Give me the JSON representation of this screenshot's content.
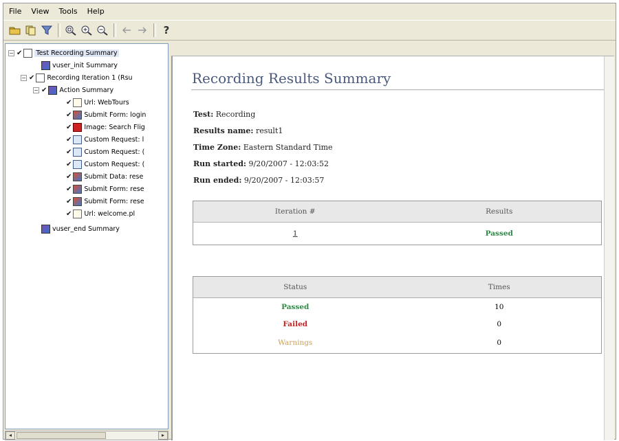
{
  "menu": [
    "File",
    "View",
    "Tools",
    "Help"
  ],
  "toolbar": {
    "icons": [
      "open-folder-icon",
      "copy-icon",
      "filter-icon",
      "zoom-fit-icon",
      "zoom-in-icon",
      "zoom-out-icon",
      "back-arrow-icon",
      "forward-arrow-icon"
    ],
    "help_label": "?"
  },
  "tree": {
    "root": "Test Recording Summary",
    "vuser_init": "vuser_init Summary",
    "iteration": "Recording Iteration 1 (Rsu",
    "action_summary": "Action Summary",
    "steps": [
      {
        "label": "Url: WebTours",
        "icon": "url-page-icon"
      },
      {
        "label": "Submit Form: login",
        "icon": "submit-form-icon"
      },
      {
        "label": "Image: Search Flig",
        "icon": "image-icon"
      },
      {
        "label": "Custom Request: l",
        "icon": "custom-request-icon"
      },
      {
        "label": "Custom Request: (",
        "icon": "custom-request-icon"
      },
      {
        "label": "Custom Request: (",
        "icon": "custom-request-icon"
      },
      {
        "label": "Submit Data: rese",
        "icon": "submit-data-icon"
      },
      {
        "label": "Submit Form: rese",
        "icon": "submit-form-icon"
      },
      {
        "label": "Submit Form: rese",
        "icon": "submit-form-icon"
      },
      {
        "label": "Url: welcome.pl",
        "icon": "url-page-icon"
      }
    ],
    "vuser_end": "vuser_end Summary"
  },
  "report": {
    "title": "Recording Results Summary",
    "meta": [
      {
        "label": "Test:",
        "value": "Recording"
      },
      {
        "label": "Results name:",
        "value": "result1"
      },
      {
        "label": "Time Zone:",
        "value": "Eastern Standard Time"
      },
      {
        "label": "Run started:",
        "value": "9/20/2007 - 12:03:52"
      },
      {
        "label": "Run ended:",
        "value": "9/20/2007 - 12:03:57"
      }
    ],
    "iteration_table": {
      "headers": [
        "Iteration #",
        "Results"
      ],
      "rows": [
        {
          "iteration": "1",
          "result": "Passed"
        }
      ]
    },
    "status_table": {
      "headers": [
        "Status",
        "Times"
      ],
      "rows": [
        {
          "status": "Passed",
          "times": "10"
        },
        {
          "status": "Failed",
          "times": "0"
        },
        {
          "status": "Warnings",
          "times": "0"
        }
      ]
    }
  },
  "colors": {
    "passed": "#2f8a46",
    "failed": "#c62020",
    "warnings": "#c9a25c",
    "title": "#4a5a7a"
  }
}
